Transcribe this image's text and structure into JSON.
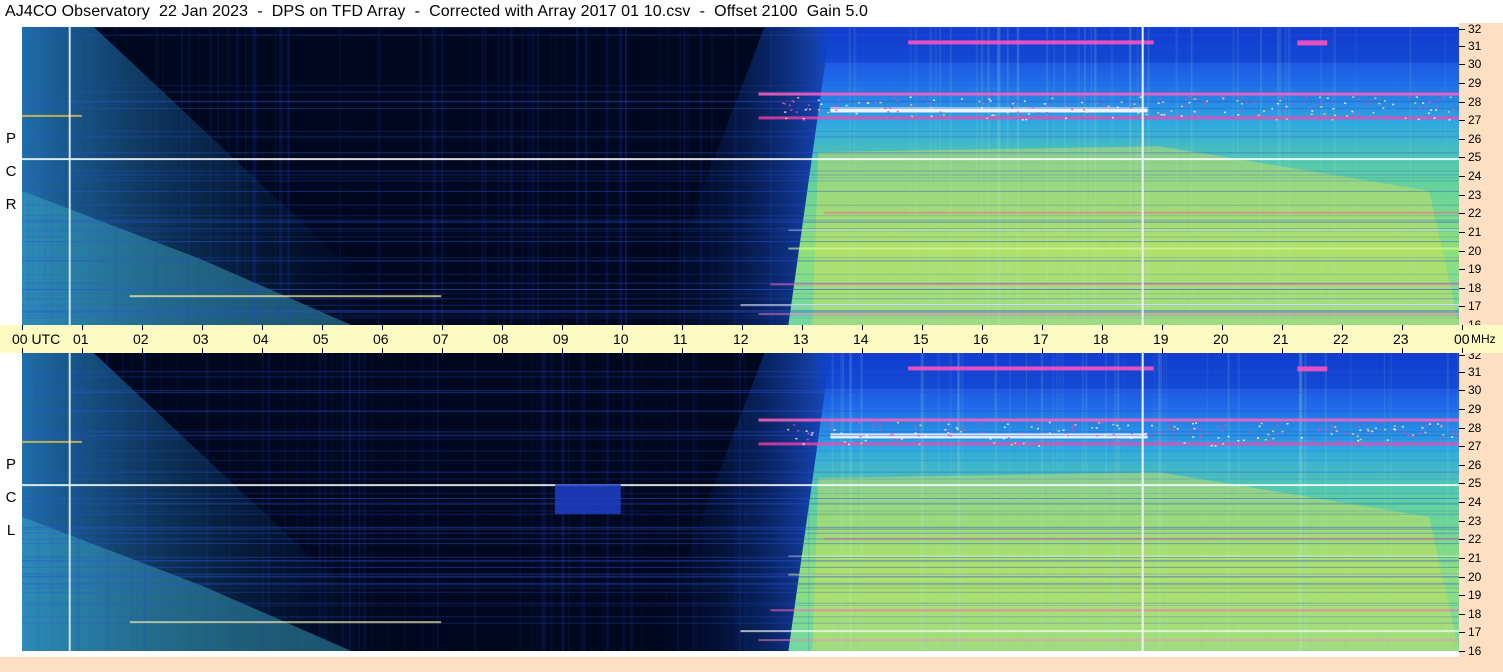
{
  "window": {
    "title": "AJ4CO Observatory  22 Jan 2023  -  DPS on TFD Array  -  Corrected with Array 2017 01 10.csv  -  Offset 2100  Gain 5.0"
  },
  "panels": [
    {
      "id": "rcp",
      "polarization_letters": [
        "P",
        "C",
        "R"
      ]
    },
    {
      "id": "lcp",
      "polarization_letters": [
        "P",
        "C",
        "L"
      ]
    }
  ],
  "time_axis": {
    "labels": [
      "00  UTC",
      "01",
      "02",
      "03",
      "04",
      "05",
      "06",
      "07",
      "08",
      "09",
      "10",
      "11",
      "12",
      "13",
      "14",
      "15",
      "16",
      "17",
      "18",
      "19",
      "20",
      "21",
      "22",
      "23",
      "00"
    ]
  },
  "freq_axis": {
    "labels": [
      "32",
      "31",
      "30",
      "29",
      "28",
      "27",
      "26",
      "25",
      "24",
      "23",
      "22",
      "21",
      "20",
      "19",
      "18",
      "17",
      "16"
    ],
    "unit": "MHz"
  },
  "colors": {
    "background": "#000820",
    "deep_blue": "#0a2a9a",
    "time_axis_bg": "#fbfbc3",
    "freq_axis_bg": "#fde0c4"
  }
}
